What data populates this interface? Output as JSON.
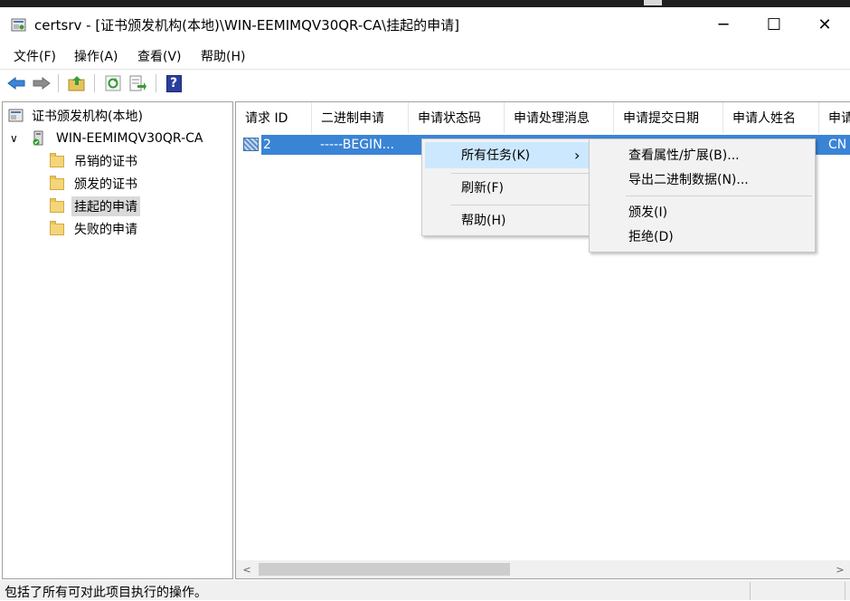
{
  "window": {
    "title": "certsrv - [证书颁发机构(本地)\\WIN-EEMIMQV30QR-CA\\挂起的申请]",
    "minimize": "─",
    "maximize": "☐",
    "close": "✕"
  },
  "menu": [
    "文件(F)",
    "操作(A)",
    "查看(V)",
    "帮助(H)"
  ],
  "toolbar": {
    "icons": [
      "back-arrow-icon",
      "forward-arrow-icon",
      "up-folder-icon",
      "refresh-icon",
      "export-list-icon",
      "help-icon"
    ],
    "help_glyph": "?"
  },
  "tree": {
    "root": "证书颁发机构(本地)",
    "ca_node": "WIN-EEMIMQV30QR-CA",
    "expander": "∨",
    "folders": [
      "吊销的证书",
      "颁发的证书",
      "挂起的申请",
      "失败的申请"
    ],
    "selected": "挂起的申请"
  },
  "list": {
    "columns": [
      "请求 ID",
      "二进制申请",
      "申请状态码",
      "申请处理消息",
      "申请提交日期",
      "申请人姓名",
      "申请"
    ],
    "rows": [
      {
        "request_id": "2",
        "binary": "-----BEGIN...",
        "last_cell": "CN"
      }
    ]
  },
  "context_menu": {
    "items": [
      "所有任务(K)",
      "刷新(F)",
      "帮助(H)"
    ],
    "submenu_arrow": "›"
  },
  "submenu": {
    "items": [
      "查看属性/扩展(B)...",
      "导出二进制数据(N)...",
      "颁发(I)",
      "拒绝(D)"
    ]
  },
  "scrollbar": {
    "left": "<",
    "right": ">"
  },
  "status": {
    "text": "包括了所有可对此项目执行的操作。"
  },
  "colors": {
    "selection": "#3a84d6",
    "menu_highlight": "#cce8ff",
    "tree_selected": "#d9d9d9"
  }
}
